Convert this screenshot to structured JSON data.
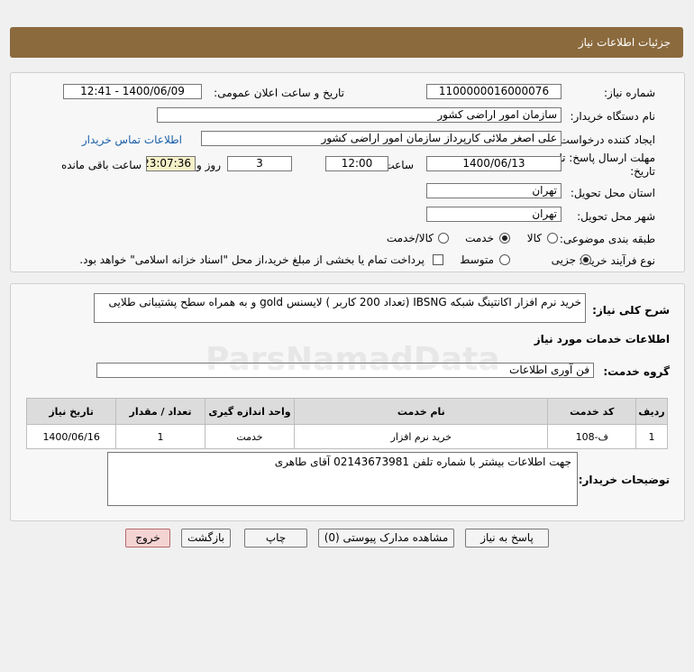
{
  "header": {
    "title": "جزئیات اطلاعات نیاز"
  },
  "form": {
    "need_number_label": "شماره نیاز:",
    "need_number": "1100000016000076",
    "announce_label": "تاریخ و ساعت اعلان عمومی:",
    "announce_value": "1400/06/09 - 12:41",
    "buyer_org_label": "نام دستگاه خریدار:",
    "buyer_org": "سازمان امور اراضی کشور",
    "requester_label": "ایجاد کننده درخواست:",
    "requester": "علی اصغر ملائی کارپرداز سازمان امور اراضی کشور",
    "contact_link": "اطلاعات تماس خریدار",
    "deadline_label_1": "مهلت ارسال پاسخ: تا",
    "deadline_label_2": "تاریخ:",
    "deadline_date": "1400/06/13",
    "time_label": "ساعت",
    "deadline_time": "12:00",
    "days_value": "3",
    "days_label": "روز و",
    "remaining_time": "23:07:36",
    "remaining_label": "ساعت باقی مانده",
    "province_label": "استان محل تحویل:",
    "province": "تهران",
    "city_label": "شهر محل تحویل:",
    "city": "تهران",
    "category_label": "طبقه بندی موضوعی:",
    "category_options": [
      "کالا",
      "خدمت",
      "کالا/خدمت"
    ],
    "category_selected": "خدمت",
    "process_label": "نوع فرآیند خرید :",
    "process_options": [
      "جزیی",
      "متوسط"
    ],
    "process_selected": "جزیی",
    "payment_note": "پرداخت تمام یا بخشی از مبلغ خرید،از محل \"اسناد خزانه اسلامی\" خواهد بود."
  },
  "details": {
    "summary_label": "شرح کلی نیاز:",
    "summary": "خرید نرم افزار اکانتینگ شبکه  IBSNG (تعداد 200 کاربر ) لایسنس gold و به همراه سطح پشتیبانی طلایی",
    "services_heading": "اطلاعات خدمات مورد نیاز",
    "service_group_label": "گروه خدمت:",
    "service_group": "فن آوری اطلاعات",
    "table": {
      "headers": [
        "ردیف",
        "کد خدمت",
        "نام خدمت",
        "واحد اندازه گیری",
        "تعداد / مقدار",
        "تاریخ نیاز"
      ],
      "rows": [
        [
          "1",
          "ف-108",
          "خرید نرم افزار",
          "خدمت",
          "1",
          "1400/06/16"
        ]
      ]
    },
    "buyer_notes_label": "توضیحات خریدار:",
    "buyer_notes": "جهت اطلاعات بیشتر با شماره تلفن 02143673981 آقای طاهری"
  },
  "buttons": {
    "reply": "پاسخ به نیاز",
    "attachments": "مشاهده مدارک پیوستی (0)",
    "print": "چاپ",
    "back": "بازگشت",
    "exit": "خروج"
  },
  "colors": {
    "header": "#8b6a3e",
    "exit_button": "#f4d3d3",
    "link": "#1a5fa8"
  }
}
